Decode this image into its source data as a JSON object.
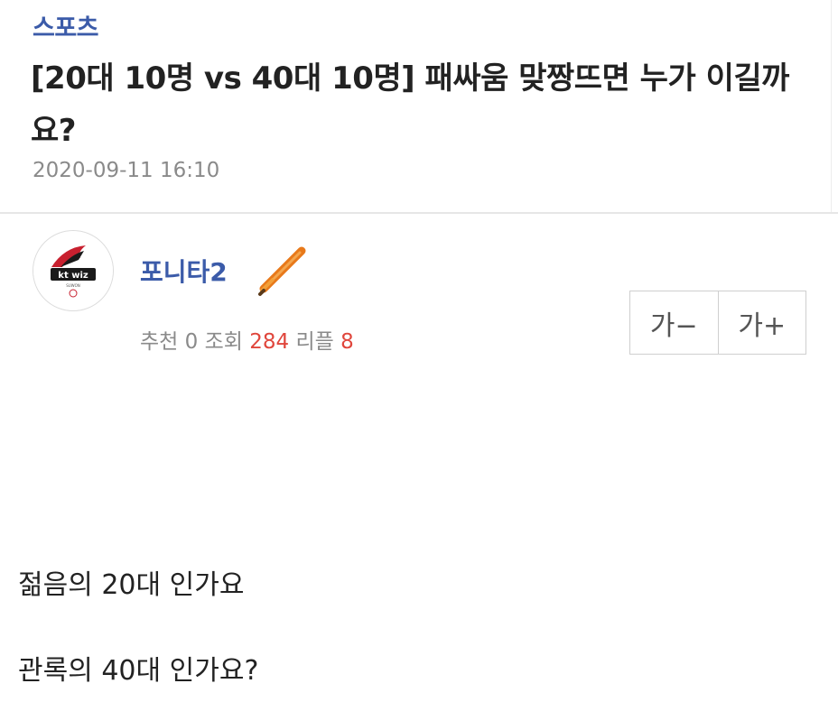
{
  "post": {
    "category": "스포츠",
    "title": "[20대 10명 vs 40대 10명] 패싸움 맞짱뜨면 누가 이길까요?",
    "date": "2020-09-11 16:10"
  },
  "author": {
    "name": "포니타2",
    "avatar_icon": "kt-wiz-logo-icon",
    "badge_icon": "baseball-bat-icon"
  },
  "stats": {
    "recommend_label": "추천",
    "recommend_value": "0",
    "views_label": "조회",
    "views_value": "284",
    "replies_label": "리플",
    "replies_value": "8"
  },
  "font_controls": {
    "decrease_label": "가−",
    "increase_label": "가+"
  },
  "content": {
    "lines": [
      "젊음의 20대 인가요",
      "관록의 40대 인가요?"
    ]
  },
  "colors": {
    "accent_blue": "#3b5ba9",
    "count_red": "#e0463c",
    "muted_gray": "#8a8a8a",
    "bat_orange": "#f08a1c"
  }
}
